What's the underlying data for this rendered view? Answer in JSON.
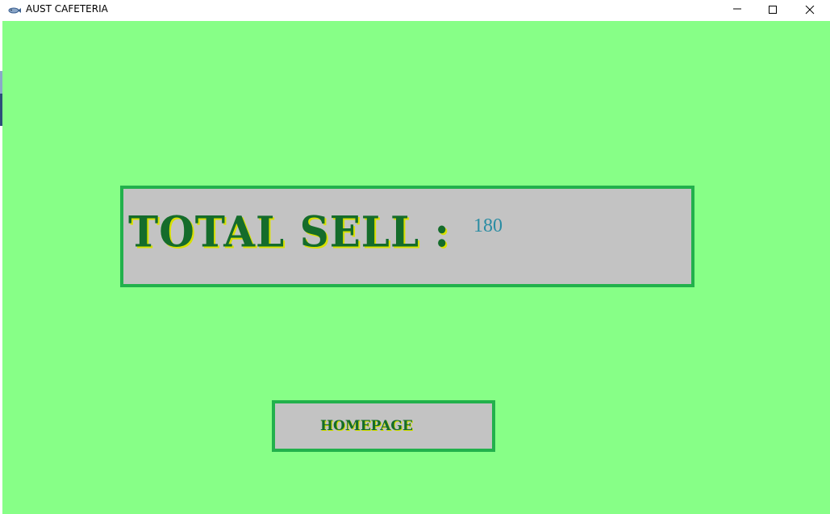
{
  "window": {
    "title": "AUST CAFETERIA",
    "app_icon": "fish-icon",
    "controls": [
      "minimize-icon",
      "maximize-icon",
      "close-icon"
    ]
  },
  "colors": {
    "background": "#87ff87",
    "panel": "#c3c3c3",
    "border": "#22b14c",
    "label_text": "#146c2b",
    "label_shadow": "#d8e000",
    "value_text": "#2a8ca3"
  },
  "sell_panel": {
    "label": "TOTAL SELL :",
    "value": "180"
  },
  "homepage_button": {
    "label": "HOMEPAGE"
  }
}
